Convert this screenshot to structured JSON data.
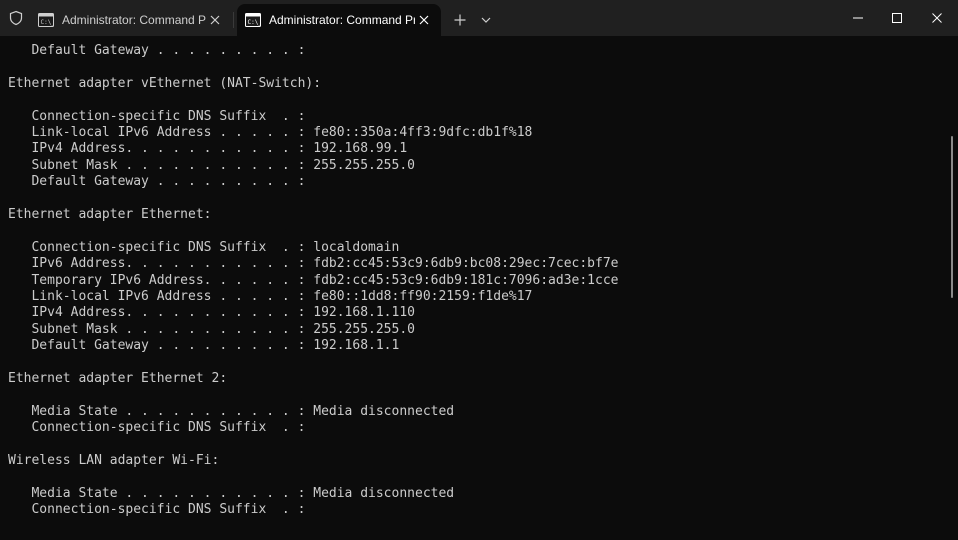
{
  "window": {
    "tabs": [
      {
        "title": "Administrator: Command Prom",
        "active": false,
        "icon": "cmd-icon"
      },
      {
        "title": "Administrator: Command Pro",
        "active": true,
        "icon": "cmd-icon"
      }
    ],
    "controls": {
      "new_tab": "+",
      "dropdown": "chevron-down-icon",
      "minimize": "minimize-icon",
      "maximize": "maximize-icon",
      "close": "close-icon"
    }
  },
  "console": {
    "lines": [
      "   Default Gateway . . . . . . . . . :",
      "",
      "Ethernet adapter vEthernet (NAT-Switch):",
      "",
      "   Connection-specific DNS Suffix  . :",
      "   Link-local IPv6 Address . . . . . : fe80::350a:4ff3:9dfc:db1f%18",
      "   IPv4 Address. . . . . . . . . . . : 192.168.99.1",
      "   Subnet Mask . . . . . . . . . . . : 255.255.255.0",
      "   Default Gateway . . . . . . . . . :",
      "",
      "Ethernet adapter Ethernet:",
      "",
      "   Connection-specific DNS Suffix  . : localdomain",
      "   IPv6 Address. . . . . . . . . . . : fdb2:cc45:53c9:6db9:bc08:29ec:7cec:bf7e",
      "   Temporary IPv6 Address. . . . . . : fdb2:cc45:53c9:6db9:181c:7096:ad3e:1cce",
      "   Link-local IPv6 Address . . . . . : fe80::1dd8:ff90:2159:f1de%17",
      "   IPv4 Address. . . . . . . . . . . : 192.168.1.110",
      "   Subnet Mask . . . . . . . . . . . : 255.255.255.0",
      "   Default Gateway . . . . . . . . . : 192.168.1.1",
      "",
      "Ethernet adapter Ethernet 2:",
      "",
      "   Media State . . . . . . . . . . . : Media disconnected",
      "   Connection-specific DNS Suffix  . :",
      "",
      "Wireless LAN adapter Wi-Fi:",
      "",
      "   Media State . . . . . . . . . . . : Media disconnected",
      "   Connection-specific DNS Suffix  . :"
    ]
  },
  "colors": {
    "background": "#0c0c0c",
    "titlebar": "#202020",
    "text": "#cccccc"
  }
}
